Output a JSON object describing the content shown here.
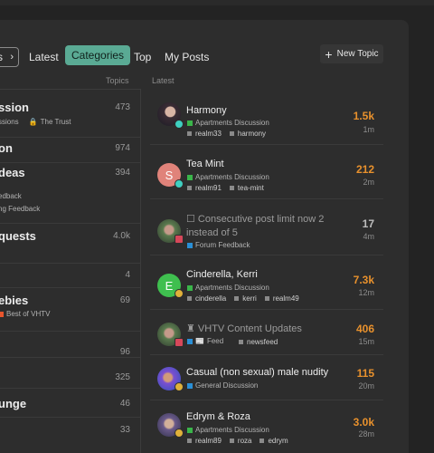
{
  "nav": {
    "dropdown_label": "s",
    "items": [
      "Latest",
      "Categories",
      "Top",
      "My Posts"
    ],
    "active": "Categories",
    "new_topic": "New Topic"
  },
  "columns": {
    "topics": "Topics",
    "latest": "Latest"
  },
  "categories": [
    {
      "name": "ssion",
      "count": "473",
      "sub": [
        "ssions",
        "The Trust"
      ]
    },
    {
      "name": "on",
      "count": "974"
    },
    {
      "name": "deas",
      "count": "394",
      "sub": [
        "edback",
        "ng Feedback"
      ]
    },
    {
      "name": "quests",
      "count": "4.0k"
    },
    {
      "name": "",
      "count": "4"
    },
    {
      "name": "ebies",
      "count": "69",
      "sub": [
        "Best of VHTV"
      ]
    },
    {
      "name": "",
      "count": "96"
    },
    {
      "name": "",
      "count": "325"
    },
    {
      "name": "unge",
      "count": "46"
    },
    {
      "name": "",
      "count": "33"
    }
  ],
  "topics": [
    {
      "title": "Harmony",
      "category": "Apartments Discussion",
      "cat_color": "#3ab54a",
      "tags": [
        "realm33",
        "harmony"
      ],
      "replies": "1.5k",
      "age": "1m",
      "hot": true
    },
    {
      "title": "Tea Mint",
      "category": "Apartments Discussion",
      "cat_color": "#3ab54a",
      "tags": [
        "realm91",
        "tea-mint"
      ],
      "replies": "212",
      "age": "2m",
      "hot": true,
      "avatar_letter": "S"
    },
    {
      "title": "☐ Consecutive post limit now 2",
      "title2": "instead of 5",
      "category": "Forum Feedback",
      "cat_color": "#2a8fd6",
      "tags": [],
      "replies": "17",
      "age": "4m",
      "hot": false,
      "muted": true
    },
    {
      "title": "Cinderella, Kerri",
      "category": "Apartments Discussion",
      "cat_color": "#3ab54a",
      "tags": [
        "cinderella",
        "kerri",
        "realm49"
      ],
      "replies": "7.3k",
      "age": "12m",
      "hot": true,
      "avatar_letter": "E"
    },
    {
      "title": "♜ VHTV Content Updates",
      "category": "Feed",
      "cat_color": "#2a8fd6",
      "tags": [
        "newsfeed"
      ],
      "replies": "406",
      "age": "15m",
      "hot": true,
      "muted": true
    },
    {
      "title": "Casual (non sexual) male nudity",
      "category": "General Discussion",
      "cat_color": "#2a8fd6",
      "tags": [],
      "replies": "115",
      "age": "20m",
      "hot": true
    },
    {
      "title": "Edrym & Roza",
      "category": "Apartments Discussion",
      "cat_color": "#3ab54a",
      "tags": [
        "realm89",
        "roza",
        "edrym"
      ],
      "replies": "3.0k",
      "age": "28m",
      "hot": true
    }
  ],
  "colors": {
    "hot": "#e8912d",
    "normal": "#bdbdbd",
    "accent": "#5aaa94"
  }
}
